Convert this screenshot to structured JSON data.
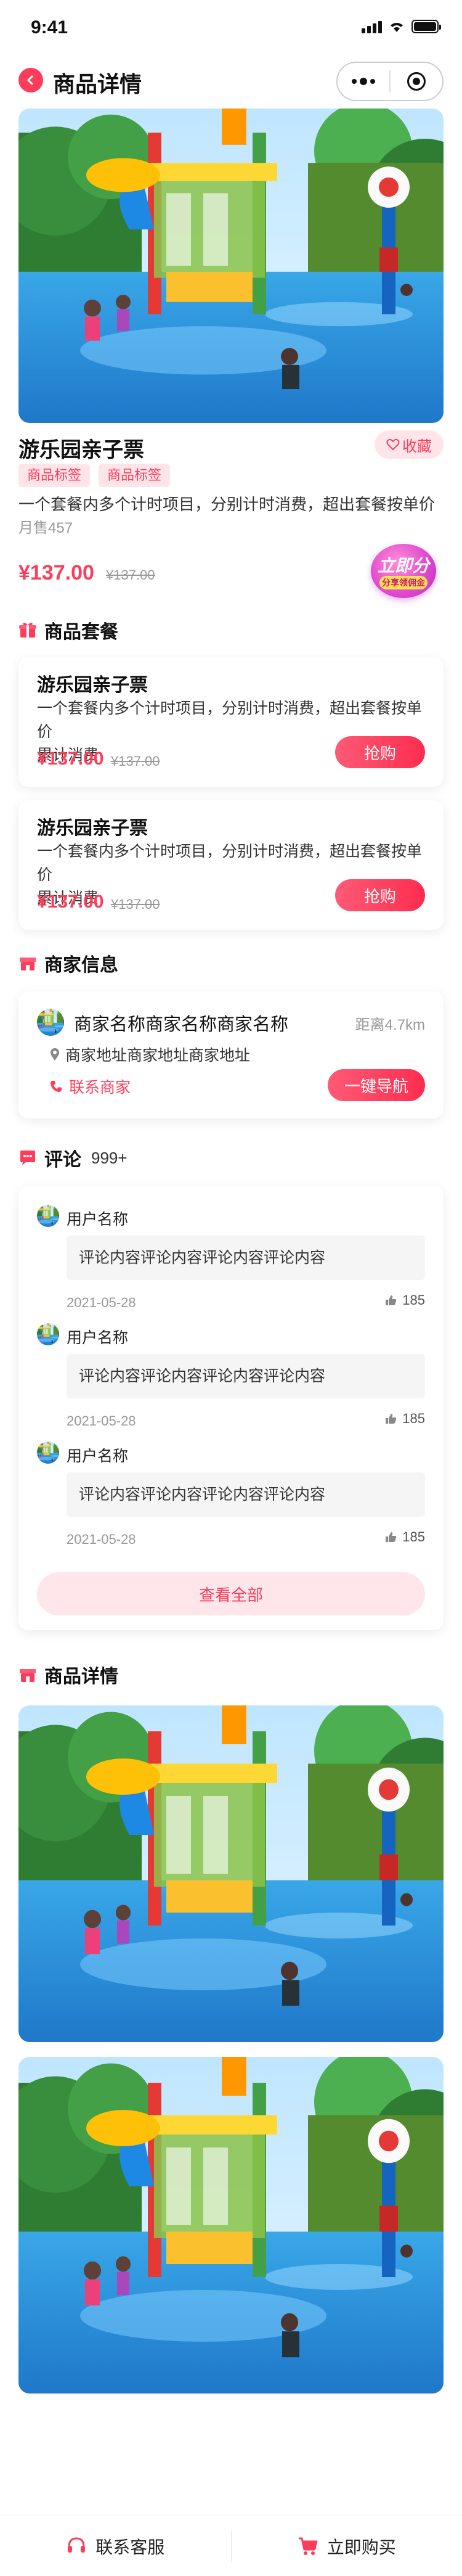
{
  "status_bar": {
    "time": "9:41"
  },
  "nav": {
    "title": "商品详情"
  },
  "product": {
    "title": "游乐园亲子票",
    "favorite_label": "收藏",
    "tags": [
      "商品标签",
      "商品标签"
    ],
    "description": "一个套餐内多个计时项目，分别计时消费，超出套餐按单价",
    "sold": "月售457",
    "price": "¥137.00",
    "original_price": "¥137.00",
    "promo_badge": {
      "main": "立即分",
      "sub": "分享领佣金"
    }
  },
  "packages": {
    "section_title": "商品套餐",
    "items": [
      {
        "title": "游乐园亲子票",
        "desc_line1": "一个套餐内多个计时项目，分别计时消费，超出套餐按单价",
        "desc_line2": "累计消费",
        "price": "¥137.00",
        "original_price": "¥137.00",
        "buy_label": "抢购"
      },
      {
        "title": "游乐园亲子票",
        "desc_line1": "一个套餐内多个计时项目，分别计时消费，超出套餐按单价",
        "desc_line2": "累计消费",
        "price": "¥137.00",
        "original_price": "¥137.00",
        "buy_label": "抢购"
      }
    ]
  },
  "merchant": {
    "section_title": "商家信息",
    "name": "商家名称商家名称商家名称",
    "distance": "距离4.7km",
    "address": "商家地址商家地址商家地址",
    "contact_label": "联系商家",
    "navigate_label": "一键导航"
  },
  "reviews": {
    "section_title": "评论",
    "count": "999+",
    "items": [
      {
        "user": "用户名称",
        "content": "评论内容评论内容评论内容评论内容",
        "date": "2021-05-28",
        "likes": "185"
      },
      {
        "user": "用户名称",
        "content": "评论内容评论内容评论内容评论内容",
        "date": "2021-05-28",
        "likes": "185"
      },
      {
        "user": "用户名称",
        "content": "评论内容评论内容评论内容评论内容",
        "date": "2021-05-28",
        "likes": "185"
      }
    ],
    "see_all_label": "查看全部"
  },
  "details": {
    "section_title": "商品详情"
  },
  "bottom_bar": {
    "service_label": "联系客服",
    "buy_label": "立即购买"
  },
  "colors": {
    "accent": "#ff3d5a",
    "accent_light": "#ffe5ea",
    "text": "#222222",
    "muted": "#999999"
  },
  "icons": [
    "back-icon",
    "more-icon",
    "target-icon",
    "heart-icon",
    "gift-icon",
    "store-icon",
    "comment-icon",
    "location-icon",
    "phone-icon",
    "thumb-up-icon",
    "headset-icon",
    "cart-icon"
  ]
}
